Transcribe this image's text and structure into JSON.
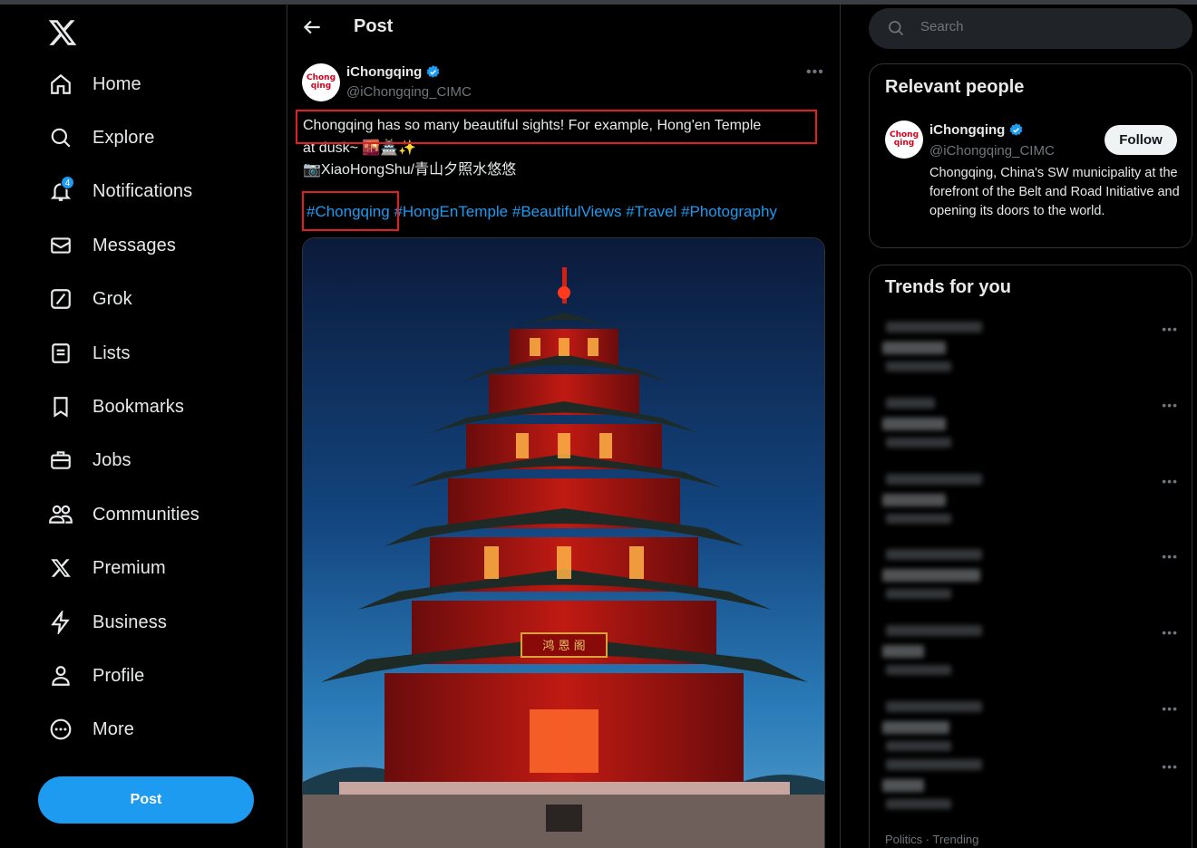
{
  "nav": {
    "items": [
      {
        "label": "Home",
        "icon": "home-icon"
      },
      {
        "label": "Explore",
        "icon": "search-icon"
      },
      {
        "label": "Notifications",
        "icon": "bell-icon",
        "badge": "4"
      },
      {
        "label": "Messages",
        "icon": "envelope-icon"
      },
      {
        "label": "Grok",
        "icon": "grok-icon"
      },
      {
        "label": "Lists",
        "icon": "list-icon"
      },
      {
        "label": "Bookmarks",
        "icon": "bookmark-icon"
      },
      {
        "label": "Jobs",
        "icon": "briefcase-icon"
      },
      {
        "label": "Communities",
        "icon": "people-icon"
      },
      {
        "label": "Premium",
        "icon": "x-logo-icon"
      },
      {
        "label": "Business",
        "icon": "lightning-icon"
      },
      {
        "label": "Profile",
        "icon": "person-icon"
      },
      {
        "label": "More",
        "icon": "more-circle-icon"
      }
    ],
    "post_button": "Post"
  },
  "header": {
    "title": "Post"
  },
  "tweet": {
    "author": "iChongqing",
    "handle": "@iChongqing_CIMC",
    "avatar_text": "Chong qing",
    "line1": "Chongqing has so many beautiful sights! For example, Hong'en Temple",
    "line2": "at dusk~ 🌇🏯✨",
    "line3": "📷XiaoHongShu/青山夕照水悠悠",
    "hashtags": [
      "#Chongqing",
      "#HongEnTemple",
      "#BeautifulViews",
      "#Travel",
      "#Photography"
    ],
    "sign_text": "鸿 恩 阁"
  },
  "search": {
    "placeholder": "Search"
  },
  "relevant": {
    "title": "Relevant people",
    "name": "iChongqing",
    "handle": "@iChongqing_CIMC",
    "follow": "Follow",
    "bio": "Chongqing, China's SW municipality at the forefront of the Belt and Road Initiative and opening its doors to the world."
  },
  "trends": {
    "title": "Trends for you",
    "last_meta": "Politics · Trending"
  },
  "colors": {
    "accent": "#1d9bf0",
    "highlight_box": "#e41e1e",
    "background": "#000000"
  }
}
